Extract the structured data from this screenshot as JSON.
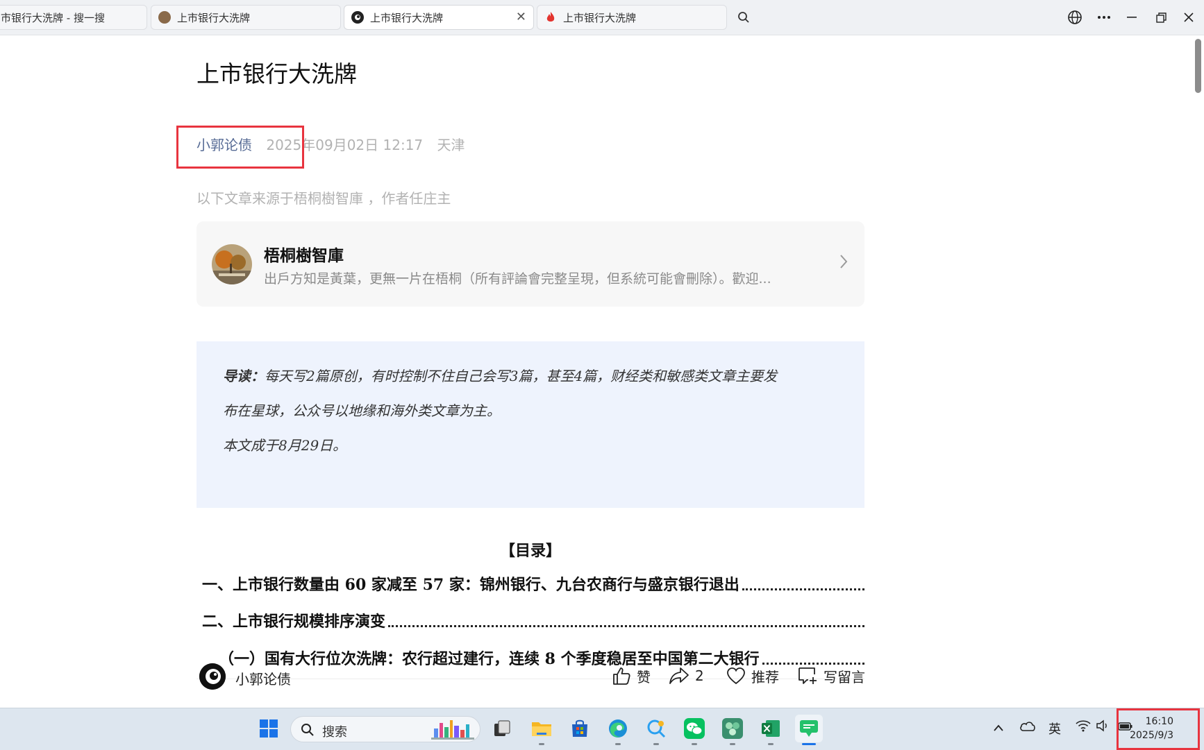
{
  "browser": {
    "tabs": [
      {
        "title": "市银行大洗牌 - 搜一搜",
        "active": false
      },
      {
        "title": "上市银行大洗牌",
        "active": false
      },
      {
        "title": "上市银行大洗牌",
        "active": true,
        "close": "✕"
      },
      {
        "title": "上市银行大洗牌",
        "active": false
      }
    ]
  },
  "article": {
    "title": "上市银行大洗牌",
    "author": "小郭论债",
    "datetime": "2025年09月02日 12:17",
    "location": "天津",
    "source_note": "以下文章来源于梧桐樹智庫 ，作者任庄主",
    "account_card": {
      "name": "梧桐樹智庫",
      "description": "出戶方知是黃葉，更無一片在梧桐（所有評論會完整呈現，但系統可能會刪除）。歡迎..."
    },
    "intro": {
      "label": "导读：",
      "line1": "每天写2篇原创，有时控制不住自己会写3篇，甚至4篇，财经类和敏感类文章主要发",
      "line2": "布在星球，公众号以地缘和海外类文章为主。",
      "line3": "本文成于8月29日。"
    },
    "toc": {
      "title": "【目录】",
      "items": [
        "一、上市银行数量由 60 家减至 57 家：锦州银行、九台农商行与盛京银行退出",
        "二、上市银行规模排序演变",
        "（一）国有大行位次洗牌：农行超过建行，连续 8 个季度稳居至中国第二大银行"
      ]
    }
  },
  "footer": {
    "account_name": "小郭论债",
    "like_label": "赞",
    "share_count": "2",
    "recommend_label": "推荐",
    "comment_label": "写留言"
  },
  "taskbar": {
    "search_label": "搜索",
    "ime_label": "英",
    "time": "16:10",
    "date": "2025/9/3"
  },
  "colors": {
    "author_link": "#576b95",
    "highlight_box": "#e8343f",
    "intro_bg": "#eef3fd"
  }
}
